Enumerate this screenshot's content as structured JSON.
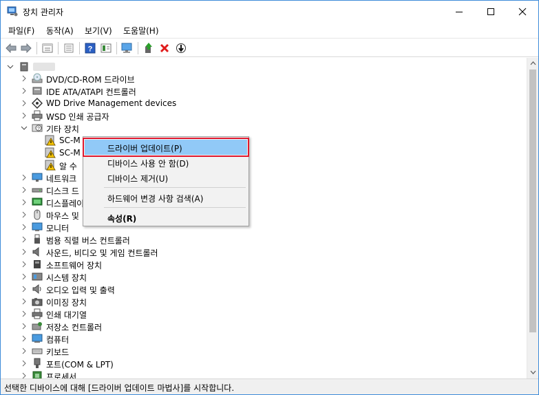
{
  "window": {
    "title": "장치 관리자"
  },
  "menu": [
    "파일(F)",
    "동작(A)",
    "보기(V)",
    "도움말(H)"
  ],
  "toolbar": {
    "icons": [
      "back-arrow-icon",
      "forward-arrow-icon",
      "properties-icon",
      "list-view-icon",
      "help-icon",
      "details-view-icon",
      "monitor-scan-icon",
      "update-driver-icon",
      "remove-device-icon",
      "install-down-icon"
    ]
  },
  "tree": {
    "categories": [
      "DVD/CD-ROM 드라이브",
      "IDE ATA/ATAPI 컨트롤러",
      "WD Drive Management devices",
      "WSD 인쇄 공급자",
      "기타 장치"
    ],
    "other_devices": [
      "SC-M",
      "SC-M",
      "알 수"
    ],
    "categories_after": [
      "네트워크",
      "디스크 드",
      "디스플레이",
      "마우스 및",
      "모니터",
      "범용 직렬 버스 컨트롤러",
      "사운드, 비디오 및 게임 컨트롤러",
      "소프트웨어 장치",
      "시스템 장치",
      "오디오 입력 및 출력",
      "이미징 장치",
      "인쇄 대기열",
      "저장소 컨트롤러",
      "컴퓨터",
      "키보드",
      "포트(COM & LPT)",
      "프로세서"
    ]
  },
  "context_menu": {
    "update_driver": "드라이버 업데이트(P)",
    "disable": "디바이스 사용 안 함(D)",
    "uninstall": "디바이스 제거(U)",
    "scan": "하드웨어 변경 사항 검색(A)",
    "properties": "속성(R)"
  },
  "status": {
    "text": "선택한 디바이스에 대해 [드라이버 업데이트 마법사]를 시작합니다."
  },
  "colors": {
    "highlight": "#91c9f7",
    "highlight_border": "#e0182e",
    "window_border": "#3c8ad9"
  }
}
